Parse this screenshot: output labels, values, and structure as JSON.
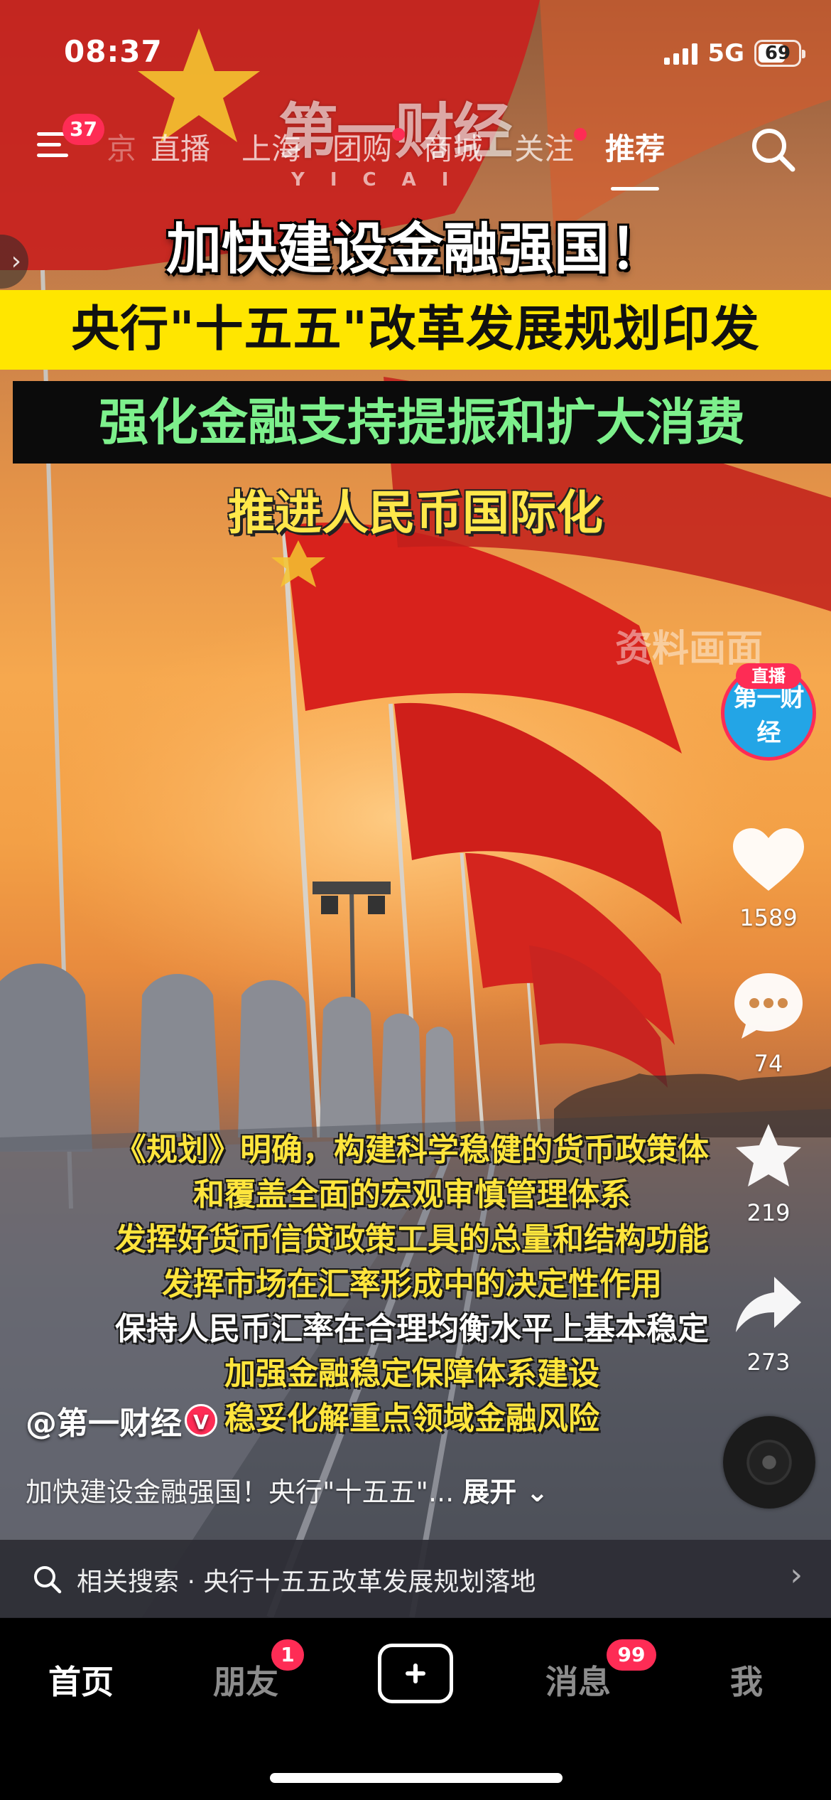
{
  "status_bar": {
    "time": "08:37",
    "network": "5G",
    "battery": "69",
    "battery_level_percent": 69,
    "signal_bars": 4
  },
  "top_nav": {
    "menu_badge": "37",
    "tabs": [
      {
        "label": "京",
        "dot": false
      },
      {
        "label": "直播",
        "dot": false
      },
      {
        "label": "上海",
        "dot": false
      },
      {
        "label": "团购",
        "dot": true
      },
      {
        "label": "商城",
        "dot": false
      },
      {
        "label": "关注",
        "dot": true
      },
      {
        "label": "推荐",
        "dot": false,
        "active": true
      }
    ],
    "search_icon": "search-icon",
    "menu_icon": "hamburger-menu-icon"
  },
  "video": {
    "logo": {
      "main": "第一财经",
      "sub": "YICAI"
    },
    "headline_1": "加快建设金融强国！",
    "headline_2": "央行\"十五五\"改革发展规划印发",
    "headline_3": "强化金融支持提振和扩大消费",
    "headline_4": "推进人民币国际化",
    "watermark": "资料画面",
    "subtitles": [
      {
        "text": "《规划》明确，构建科学稳健的货币政策体",
        "color": "yellow"
      },
      {
        "text": "和覆盖全面的宏观审慎管理体系",
        "color": "yellow"
      },
      {
        "text": "发挥好货币信贷政策工具的总量和结构功能",
        "color": "yellow"
      },
      {
        "text": "发挥市场在汇率形成中的决定性作用",
        "color": "yellow"
      },
      {
        "text": "保持人民币汇率在合理均衡水平上基本稳定",
        "color": "white"
      },
      {
        "text": "加强金融稳定保障体系建设",
        "color": "yellow"
      },
      {
        "text": "稳妥化解重点领域金融风险",
        "color": "yellow"
      }
    ]
  },
  "right_rail": {
    "avatar_live_tag": "直播",
    "avatar_text": "第一财经",
    "likes": "1589",
    "comments": "74",
    "favorites": "219",
    "shares": "273"
  },
  "post": {
    "author": "@第一财经",
    "verified_mark": "V",
    "caption": "加快建设金融强国！央行\"十五五\"...",
    "expand": "展开",
    "related_search": "相关搜索 · 央行十五五改革发展规划落地"
  },
  "tab_bar": {
    "home": "首页",
    "friends": "朋友",
    "friends_badge": "1",
    "messages": "消息",
    "messages_badge": "99",
    "me": "我"
  },
  "colors": {
    "accent": "#fe2c55",
    "headline_yellow": "#ffe600",
    "subtitle_yellow": "#ffe53d",
    "headline_green": "#7df08c"
  }
}
